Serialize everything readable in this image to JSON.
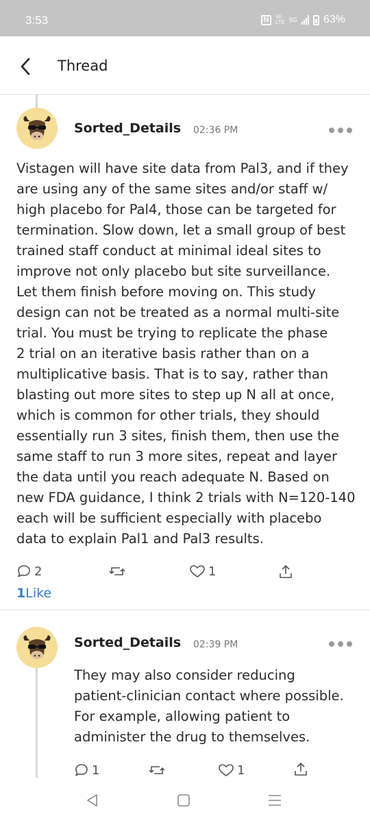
{
  "status_bar": {
    "time": "3:53",
    "net": "5G",
    "battery": "63%"
  },
  "header": {
    "back_icon": "chevron-left-icon",
    "title": "Thread"
  },
  "posts": [
    {
      "username": "Sorted_Details",
      "time": "02:36 PM",
      "body": "Vistagen will have site data from Pal3, and if they\nare using any of the same sites and/or staff w/\nhigh placebo for Pal4, those can be targeted for\ntermination. Slow down, let a small group of best\ntrained staff conduct at minimal ideal sites to\nimprove not only placebo but site surveillance.\nLet them finish before moving on. This study\ndesign can not be treated as a normal multi-site\ntrial. You must be trying to replicate the phase\n2 trial  on an iterative basis rather than on a\nmultiplicative basis. That is to say, rather than\nblasting out more sites to step up N all at once,\nwhich is common for other trials, they should\nessentially run 3 sites, finish them, then use the\nsame staff to run 3 more sites, repeat and layer\nthe data until you reach adequate N. Based on\nnew FDA guidance, I think 2 trials with N=120-140\neach will be sufficient especially with placebo\ndata to explain Pal1 and Pal3 results.",
      "replies": "2",
      "likes": "1",
      "like_num": "1",
      "like_word": "Like"
    },
    {
      "username": "Sorted_Details",
      "time": "02:39 PM",
      "body": "They may also consider reducing\npatient-clinician contact where possible.\nFor example, allowing patient to\nadminister the drug to themselves.",
      "replies": "1",
      "likes": "1"
    }
  ],
  "colors": {
    "accent": "#3b7fc4",
    "avatar_bg": "#f6dd98",
    "status_bar_bg": "#c4c4c4"
  }
}
